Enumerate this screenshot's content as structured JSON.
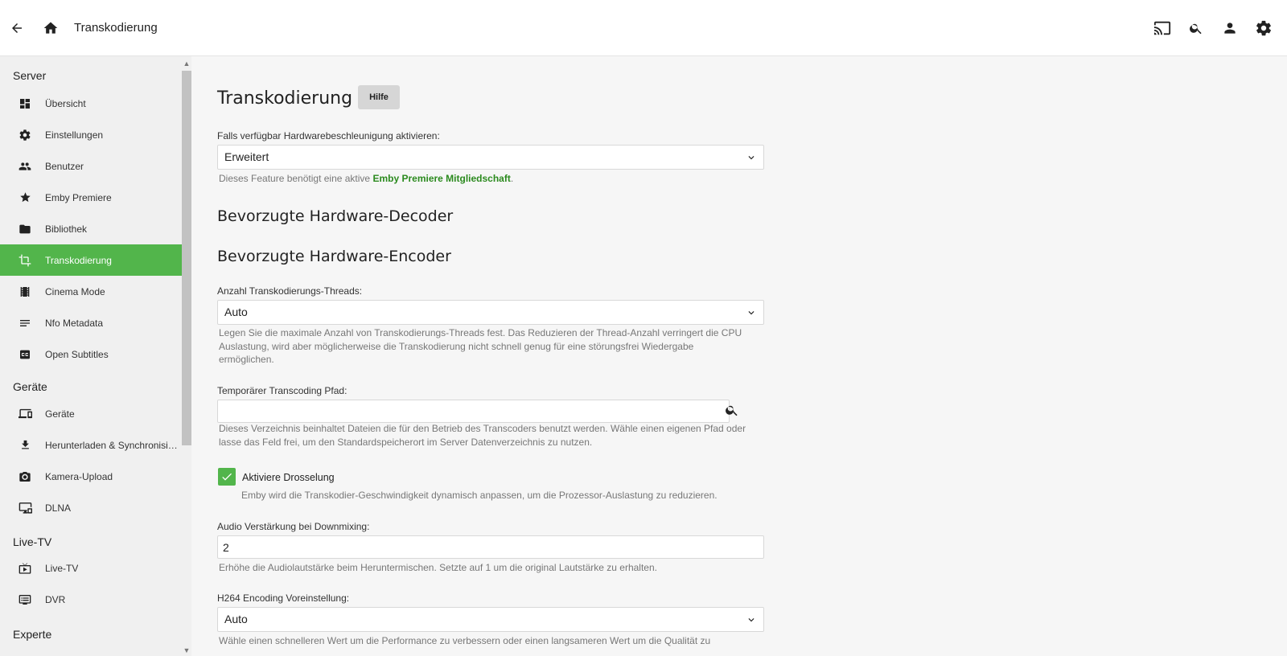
{
  "header": {
    "title": "Transkodierung"
  },
  "sidebar": {
    "sections": [
      {
        "title": "Server"
      },
      {
        "title": "Geräte"
      },
      {
        "title": "Live-TV"
      },
      {
        "title": "Experte"
      }
    ],
    "items": [
      {
        "label": "Übersicht",
        "icon": "dashboard-icon"
      },
      {
        "label": "Einstellungen",
        "icon": "gear-icon"
      },
      {
        "label": "Benutzer",
        "icon": "people-icon"
      },
      {
        "label": "Emby Premiere",
        "icon": "star-icon"
      },
      {
        "label": "Bibliothek",
        "icon": "folder-icon"
      },
      {
        "label": "Transkodierung",
        "icon": "transcode-icon",
        "active": true
      },
      {
        "label": "Cinema Mode",
        "icon": "film-icon"
      },
      {
        "label": "Nfo Metadata",
        "icon": "lines-icon"
      },
      {
        "label": "Open Subtitles",
        "icon": "cc-icon"
      },
      {
        "label": "Geräte",
        "icon": "devices-icon"
      },
      {
        "label": "Herunterladen & Synchronisieren",
        "icon": "download-icon"
      },
      {
        "label": "Kamera-Upload",
        "icon": "camera-icon"
      },
      {
        "label": "DLNA",
        "icon": "dlna-icon"
      },
      {
        "label": "Live-TV",
        "icon": "live-tv-icon"
      },
      {
        "label": "DVR",
        "icon": "dvr-icon"
      }
    ]
  },
  "main": {
    "title": "Transkodierung",
    "help_label": "Hilfe",
    "hw_accel": {
      "label": "Falls verfügbar Hardwarebeschleunigung aktivieren:",
      "value": "Erweitert",
      "desc_prefix": "Dieses Feature benötigt eine aktive ",
      "desc_link": "Emby Premiere Mitgliedschaft",
      "desc_suffix": "."
    },
    "decoder_heading": "Bevorzugte Hardware-Decoder",
    "encoder_heading": "Bevorzugte Hardware-Encoder",
    "threads": {
      "label": "Anzahl Transkodierungs-Threads:",
      "value": "Auto",
      "desc": "Legen Sie die maximale Anzahl von Transkodierungs-Threads fest. Das Reduzieren der Thread-Anzahl verringert die CPU Auslastung, wird aber möglicherweise die Transkodierung nicht schnell genug für eine störungsfrei Wiedergabe ermöglichen."
    },
    "temp_path": {
      "label": "Temporärer Transcoding Pfad:",
      "value": "",
      "desc": "Dieses Verzeichnis beinhaltet Dateien die für den Betrieb des Transcoders benutzt werden. Wähle einen eigenen Pfad oder lasse das Feld frei, um den Standardspeicherort im Server Datenverzeichnis zu nutzen."
    },
    "throttle": {
      "label": "Aktiviere Drosselung",
      "checked": true,
      "desc": "Emby wird die Transkodier-Geschwindigkeit dynamisch anpassen, um die Prozessor-Auslastung zu reduzieren."
    },
    "audio_boost": {
      "label": "Audio Verstärkung bei Downmixing:",
      "value": "2",
      "desc": "Erhöhe die Audiolautstärke beim Heruntermischen. Setzte auf 1 um die original Lautstärke zu erhalten."
    },
    "h264": {
      "label": "H264 Encoding Voreinstellung:",
      "value": "Auto",
      "desc": "Wähle einen schnelleren Wert um die Performance zu verbessern oder einen langsameren Wert um die Qualität zu"
    }
  },
  "colors": {
    "accent": "#52b54b",
    "link": "#2b8a1e"
  }
}
